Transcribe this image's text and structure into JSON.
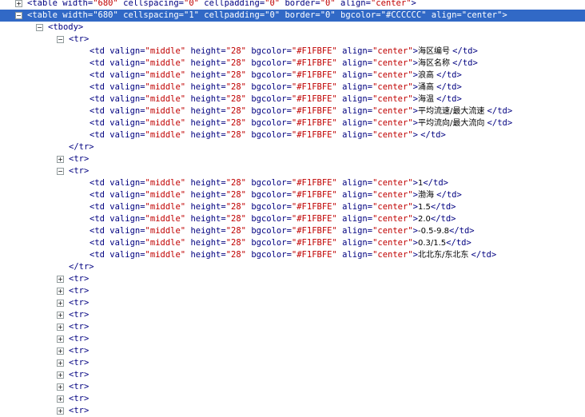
{
  "toggle_glyphs": {
    "expanded": "−",
    "collapsed": "+"
  },
  "rows": [
    {
      "indent": 0,
      "toggle": "collapsed",
      "selected": false,
      "parts": [
        {
          "k": "t",
          "s": "<table"
        },
        {
          "k": "a",
          "s": " width="
        },
        {
          "k": "v",
          "s": "\"680\""
        },
        {
          "k": "a",
          "s": " cellspacing="
        },
        {
          "k": "v",
          "s": "\"0\""
        },
        {
          "k": "a",
          "s": " cellpadding="
        },
        {
          "k": "v",
          "s": "\"0\""
        },
        {
          "k": "a",
          "s": " border="
        },
        {
          "k": "v",
          "s": "\"0\""
        },
        {
          "k": "a",
          "s": " align="
        },
        {
          "k": "v",
          "s": "\"center\""
        },
        {
          "k": "t",
          "s": ">"
        }
      ]
    },
    {
      "indent": 0,
      "toggle": "expanded",
      "selected": true,
      "parts": [
        {
          "k": "t",
          "s": "<table"
        },
        {
          "k": "a",
          "s": " width="
        },
        {
          "k": "v",
          "s": "\"680\""
        },
        {
          "k": "a",
          "s": " cellspacing="
        },
        {
          "k": "v",
          "s": "\"1\""
        },
        {
          "k": "a",
          "s": " cellpadding="
        },
        {
          "k": "v",
          "s": "\"0\""
        },
        {
          "k": "a",
          "s": " border="
        },
        {
          "k": "v",
          "s": "\"0\""
        },
        {
          "k": "a",
          "s": " bgcolor="
        },
        {
          "k": "v",
          "s": "\"#CCCCCC\""
        },
        {
          "k": "a",
          "s": " align="
        },
        {
          "k": "v",
          "s": "\"center\""
        },
        {
          "k": "t",
          "s": ">"
        }
      ]
    },
    {
      "indent": 1,
      "toggle": "expanded",
      "selected": false,
      "parts": [
        {
          "k": "t",
          "s": "<tbody>"
        }
      ]
    },
    {
      "indent": 2,
      "toggle": "expanded",
      "selected": false,
      "parts": [
        {
          "k": "t",
          "s": "<tr>"
        }
      ]
    },
    {
      "indent": 3,
      "toggle": null,
      "selected": false,
      "parts": [
        {
          "k": "t",
          "s": "<td"
        },
        {
          "k": "a",
          "s": " valign="
        },
        {
          "k": "v",
          "s": "\"middle\""
        },
        {
          "k": "a",
          "s": " height="
        },
        {
          "k": "v",
          "s": "\"28\""
        },
        {
          "k": "a",
          "s": " bgcolor="
        },
        {
          "k": "v",
          "s": "\"#F1FBFE\""
        },
        {
          "k": "a",
          "s": " align="
        },
        {
          "k": "v",
          "s": "\"center\""
        },
        {
          "k": "t",
          "s": ">"
        },
        {
          "k": "x",
          "s": "海区编号 "
        },
        {
          "k": "t",
          "s": "</td>"
        }
      ]
    },
    {
      "indent": 3,
      "toggle": null,
      "selected": false,
      "parts": [
        {
          "k": "t",
          "s": "<td"
        },
        {
          "k": "a",
          "s": " valign="
        },
        {
          "k": "v",
          "s": "\"middle\""
        },
        {
          "k": "a",
          "s": " height="
        },
        {
          "k": "v",
          "s": "\"28\""
        },
        {
          "k": "a",
          "s": " bgcolor="
        },
        {
          "k": "v",
          "s": "\"#F1FBFE\""
        },
        {
          "k": "a",
          "s": " align="
        },
        {
          "k": "v",
          "s": "\"center\""
        },
        {
          "k": "t",
          "s": ">"
        },
        {
          "k": "x",
          "s": "海区名称 "
        },
        {
          "k": "t",
          "s": "</td>"
        }
      ]
    },
    {
      "indent": 3,
      "toggle": null,
      "selected": false,
      "parts": [
        {
          "k": "t",
          "s": "<td"
        },
        {
          "k": "a",
          "s": " valign="
        },
        {
          "k": "v",
          "s": "\"middle\""
        },
        {
          "k": "a",
          "s": " height="
        },
        {
          "k": "v",
          "s": "\"28\""
        },
        {
          "k": "a",
          "s": " bgcolor="
        },
        {
          "k": "v",
          "s": "\"#F1FBFE\""
        },
        {
          "k": "a",
          "s": " align="
        },
        {
          "k": "v",
          "s": "\"center\""
        },
        {
          "k": "t",
          "s": ">"
        },
        {
          "k": "x",
          "s": "浪高 "
        },
        {
          "k": "t",
          "s": "</td>"
        }
      ]
    },
    {
      "indent": 3,
      "toggle": null,
      "selected": false,
      "parts": [
        {
          "k": "t",
          "s": "<td"
        },
        {
          "k": "a",
          "s": " valign="
        },
        {
          "k": "v",
          "s": "\"middle\""
        },
        {
          "k": "a",
          "s": " height="
        },
        {
          "k": "v",
          "s": "\"28\""
        },
        {
          "k": "a",
          "s": " bgcolor="
        },
        {
          "k": "v",
          "s": "\"#F1FBFE\""
        },
        {
          "k": "a",
          "s": " align="
        },
        {
          "k": "v",
          "s": "\"center\""
        },
        {
          "k": "t",
          "s": ">"
        },
        {
          "k": "x",
          "s": "涌高 "
        },
        {
          "k": "t",
          "s": "</td>"
        }
      ]
    },
    {
      "indent": 3,
      "toggle": null,
      "selected": false,
      "parts": [
        {
          "k": "t",
          "s": "<td"
        },
        {
          "k": "a",
          "s": " valign="
        },
        {
          "k": "v",
          "s": "\"middle\""
        },
        {
          "k": "a",
          "s": " height="
        },
        {
          "k": "v",
          "s": "\"28\""
        },
        {
          "k": "a",
          "s": " bgcolor="
        },
        {
          "k": "v",
          "s": "\"#F1FBFE\""
        },
        {
          "k": "a",
          "s": " align="
        },
        {
          "k": "v",
          "s": "\"center\""
        },
        {
          "k": "t",
          "s": ">"
        },
        {
          "k": "x",
          "s": "海温 "
        },
        {
          "k": "t",
          "s": "</td>"
        }
      ]
    },
    {
      "indent": 3,
      "toggle": null,
      "selected": false,
      "parts": [
        {
          "k": "t",
          "s": "<td"
        },
        {
          "k": "a",
          "s": " valign="
        },
        {
          "k": "v",
          "s": "\"middle\""
        },
        {
          "k": "a",
          "s": " height="
        },
        {
          "k": "v",
          "s": "\"28\""
        },
        {
          "k": "a",
          "s": " bgcolor="
        },
        {
          "k": "v",
          "s": "\"#F1FBFE\""
        },
        {
          "k": "a",
          "s": " align="
        },
        {
          "k": "v",
          "s": "\"center\""
        },
        {
          "k": "t",
          "s": ">"
        },
        {
          "k": "x",
          "s": "平均流速/最大流速 "
        },
        {
          "k": "t",
          "s": "</td>"
        }
      ]
    },
    {
      "indent": 3,
      "toggle": null,
      "selected": false,
      "parts": [
        {
          "k": "t",
          "s": "<td"
        },
        {
          "k": "a",
          "s": " valign="
        },
        {
          "k": "v",
          "s": "\"middle\""
        },
        {
          "k": "a",
          "s": " height="
        },
        {
          "k": "v",
          "s": "\"28\""
        },
        {
          "k": "a",
          "s": " bgcolor="
        },
        {
          "k": "v",
          "s": "\"#F1FBFE\""
        },
        {
          "k": "a",
          "s": " align="
        },
        {
          "k": "v",
          "s": "\"center\""
        },
        {
          "k": "t",
          "s": ">"
        },
        {
          "k": "x",
          "s": "平均流向/最大流向 "
        },
        {
          "k": "t",
          "s": "</td>"
        }
      ]
    },
    {
      "indent": 3,
      "toggle": null,
      "selected": false,
      "parts": [
        {
          "k": "t",
          "s": "<td"
        },
        {
          "k": "a",
          "s": " valign="
        },
        {
          "k": "v",
          "s": "\"middle\""
        },
        {
          "k": "a",
          "s": " height="
        },
        {
          "k": "v",
          "s": "\"28\""
        },
        {
          "k": "a",
          "s": " bgcolor="
        },
        {
          "k": "v",
          "s": "\"#F1FBFE\""
        },
        {
          "k": "a",
          "s": " align="
        },
        {
          "k": "v",
          "s": "\"center\""
        },
        {
          "k": "t",
          "s": ">"
        },
        {
          "k": "x",
          "s": "  "
        },
        {
          "k": "t",
          "s": "</td>"
        }
      ]
    },
    {
      "indent": 2,
      "toggle": null,
      "selected": false,
      "parts": [
        {
          "k": "t",
          "s": "</tr>"
        }
      ]
    },
    {
      "indent": 2,
      "toggle": "collapsed",
      "selected": false,
      "parts": [
        {
          "k": "t",
          "s": "<tr>"
        }
      ]
    },
    {
      "indent": 2,
      "toggle": "expanded",
      "selected": false,
      "parts": [
        {
          "k": "t",
          "s": "<tr>"
        }
      ]
    },
    {
      "indent": 3,
      "toggle": null,
      "selected": false,
      "parts": [
        {
          "k": "t",
          "s": "<td"
        },
        {
          "k": "a",
          "s": " valign="
        },
        {
          "k": "v",
          "s": "\"middle\""
        },
        {
          "k": "a",
          "s": " height="
        },
        {
          "k": "v",
          "s": "\"28\""
        },
        {
          "k": "a",
          "s": " bgcolor="
        },
        {
          "k": "v",
          "s": "\"#F1FBFE\""
        },
        {
          "k": "a",
          "s": " align="
        },
        {
          "k": "v",
          "s": "\"center\""
        },
        {
          "k": "t",
          "s": ">"
        },
        {
          "k": "x",
          "s": "1"
        },
        {
          "k": "t",
          "s": "</td>"
        }
      ]
    },
    {
      "indent": 3,
      "toggle": null,
      "selected": false,
      "parts": [
        {
          "k": "t",
          "s": "<td"
        },
        {
          "k": "a",
          "s": " valign="
        },
        {
          "k": "v",
          "s": "\"middle\""
        },
        {
          "k": "a",
          "s": " height="
        },
        {
          "k": "v",
          "s": "\"28\""
        },
        {
          "k": "a",
          "s": " bgcolor="
        },
        {
          "k": "v",
          "s": "\"#F1FBFE\""
        },
        {
          "k": "a",
          "s": " align="
        },
        {
          "k": "v",
          "s": "\"center\""
        },
        {
          "k": "t",
          "s": ">"
        },
        {
          "k": "x",
          "s": "渤海 "
        },
        {
          "k": "t",
          "s": "</td>"
        }
      ]
    },
    {
      "indent": 3,
      "toggle": null,
      "selected": false,
      "parts": [
        {
          "k": "t",
          "s": "<td"
        },
        {
          "k": "a",
          "s": " valign="
        },
        {
          "k": "v",
          "s": "\"middle\""
        },
        {
          "k": "a",
          "s": " height="
        },
        {
          "k": "v",
          "s": "\"28\""
        },
        {
          "k": "a",
          "s": " bgcolor="
        },
        {
          "k": "v",
          "s": "\"#F1FBFE\""
        },
        {
          "k": "a",
          "s": " align="
        },
        {
          "k": "v",
          "s": "\"center\""
        },
        {
          "k": "t",
          "s": ">"
        },
        {
          "k": "x",
          "s": "1.5"
        },
        {
          "k": "t",
          "s": "</td>"
        }
      ]
    },
    {
      "indent": 3,
      "toggle": null,
      "selected": false,
      "parts": [
        {
          "k": "t",
          "s": "<td"
        },
        {
          "k": "a",
          "s": " valign="
        },
        {
          "k": "v",
          "s": "\"middle\""
        },
        {
          "k": "a",
          "s": " height="
        },
        {
          "k": "v",
          "s": "\"28\""
        },
        {
          "k": "a",
          "s": " bgcolor="
        },
        {
          "k": "v",
          "s": "\"#F1FBFE\""
        },
        {
          "k": "a",
          "s": " align="
        },
        {
          "k": "v",
          "s": "\"center\""
        },
        {
          "k": "t",
          "s": ">"
        },
        {
          "k": "x",
          "s": "2.0"
        },
        {
          "k": "t",
          "s": "</td>"
        }
      ]
    },
    {
      "indent": 3,
      "toggle": null,
      "selected": false,
      "parts": [
        {
          "k": "t",
          "s": "<td"
        },
        {
          "k": "a",
          "s": " valign="
        },
        {
          "k": "v",
          "s": "\"middle\""
        },
        {
          "k": "a",
          "s": " height="
        },
        {
          "k": "v",
          "s": "\"28\""
        },
        {
          "k": "a",
          "s": " bgcolor="
        },
        {
          "k": "v",
          "s": "\"#F1FBFE\""
        },
        {
          "k": "a",
          "s": " align="
        },
        {
          "k": "v",
          "s": "\"center\""
        },
        {
          "k": "t",
          "s": ">"
        },
        {
          "k": "x",
          "s": "-0.5-9.8"
        },
        {
          "k": "t",
          "s": "</td>"
        }
      ]
    },
    {
      "indent": 3,
      "toggle": null,
      "selected": false,
      "parts": [
        {
          "k": "t",
          "s": "<td"
        },
        {
          "k": "a",
          "s": " valign="
        },
        {
          "k": "v",
          "s": "\"middle\""
        },
        {
          "k": "a",
          "s": " height="
        },
        {
          "k": "v",
          "s": "\"28\""
        },
        {
          "k": "a",
          "s": " bgcolor="
        },
        {
          "k": "v",
          "s": "\"#F1FBFE\""
        },
        {
          "k": "a",
          "s": " align="
        },
        {
          "k": "v",
          "s": "\"center\""
        },
        {
          "k": "t",
          "s": ">"
        },
        {
          "k": "x",
          "s": "0.3/1.5"
        },
        {
          "k": "t",
          "s": "</td>"
        }
      ]
    },
    {
      "indent": 3,
      "toggle": null,
      "selected": false,
      "parts": [
        {
          "k": "t",
          "s": "<td"
        },
        {
          "k": "a",
          "s": " valign="
        },
        {
          "k": "v",
          "s": "\"middle\""
        },
        {
          "k": "a",
          "s": " height="
        },
        {
          "k": "v",
          "s": "\"28\""
        },
        {
          "k": "a",
          "s": " bgcolor="
        },
        {
          "k": "v",
          "s": "\"#F1FBFE\""
        },
        {
          "k": "a",
          "s": " align="
        },
        {
          "k": "v",
          "s": "\"center\""
        },
        {
          "k": "t",
          "s": ">"
        },
        {
          "k": "x",
          "s": "北北东/东北东 "
        },
        {
          "k": "t",
          "s": "</td>"
        }
      ]
    },
    {
      "indent": 2,
      "toggle": null,
      "selected": false,
      "parts": [
        {
          "k": "t",
          "s": "</tr>"
        }
      ]
    },
    {
      "indent": 2,
      "toggle": "collapsed",
      "selected": false,
      "parts": [
        {
          "k": "t",
          "s": "<tr>"
        }
      ]
    },
    {
      "indent": 2,
      "toggle": "collapsed",
      "selected": false,
      "parts": [
        {
          "k": "t",
          "s": "<tr>"
        }
      ]
    },
    {
      "indent": 2,
      "toggle": "collapsed",
      "selected": false,
      "parts": [
        {
          "k": "t",
          "s": "<tr>"
        }
      ]
    },
    {
      "indent": 2,
      "toggle": "collapsed",
      "selected": false,
      "parts": [
        {
          "k": "t",
          "s": "<tr>"
        }
      ]
    },
    {
      "indent": 2,
      "toggle": "collapsed",
      "selected": false,
      "parts": [
        {
          "k": "t",
          "s": "<tr>"
        }
      ]
    },
    {
      "indent": 2,
      "toggle": "collapsed",
      "selected": false,
      "parts": [
        {
          "k": "t",
          "s": "<tr>"
        }
      ]
    },
    {
      "indent": 2,
      "toggle": "collapsed",
      "selected": false,
      "parts": [
        {
          "k": "t",
          "s": "<tr>"
        }
      ]
    },
    {
      "indent": 2,
      "toggle": "collapsed",
      "selected": false,
      "parts": [
        {
          "k": "t",
          "s": "<tr>"
        }
      ]
    },
    {
      "indent": 2,
      "toggle": "collapsed",
      "selected": false,
      "parts": [
        {
          "k": "t",
          "s": "<tr>"
        }
      ]
    },
    {
      "indent": 2,
      "toggle": "collapsed",
      "selected": false,
      "parts": [
        {
          "k": "t",
          "s": "<tr>"
        }
      ]
    },
    {
      "indent": 2,
      "toggle": "collapsed",
      "selected": false,
      "parts": [
        {
          "k": "t",
          "s": "<tr>"
        }
      ]
    },
    {
      "indent": 2,
      "toggle": "collapsed",
      "selected": false,
      "parts": [
        {
          "k": "t",
          "s": "<tr>"
        }
      ]
    }
  ]
}
